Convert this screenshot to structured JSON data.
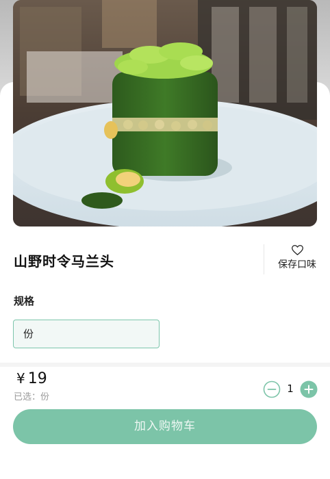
{
  "product": {
    "title": "山野时令马兰头",
    "image_alt": "山野时令马兰头"
  },
  "favorite": {
    "icon": "heart-outline-icon",
    "label": "保存口味"
  },
  "spec": {
    "label": "规格",
    "options": [
      "份"
    ],
    "selected": "份"
  },
  "summary": {
    "currency": "¥",
    "price": "19",
    "selected_text": "已选：份"
  },
  "quantity": {
    "value": "1",
    "minus_icon": "minus-circle-icon",
    "plus_icon": "plus-circle-icon"
  },
  "actions": {
    "add_to_cart": "加入购物车"
  },
  "colors": {
    "accent": "#7cc4a8",
    "accent_light": "#f2f8f6",
    "accent_border": "#7cc5ab"
  }
}
